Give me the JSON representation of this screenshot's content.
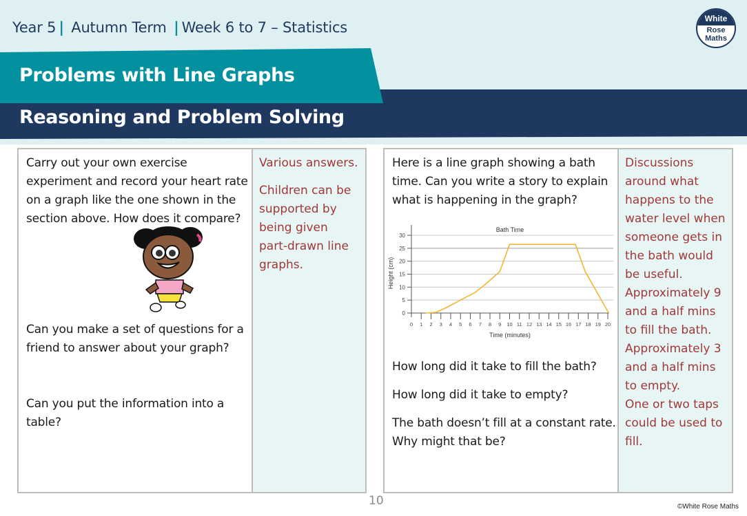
{
  "header": {
    "breadcrumb": {
      "year": "Year 5",
      "term": "Autumn Term",
      "week": "Week 6 to 7 – Statistics",
      "separator": "|"
    },
    "title": "Problems with Line Graphs",
    "subtitle": "Reasoning and Problem Solving",
    "logo": {
      "line1": "White",
      "line2": "Rose",
      "line3": "Maths"
    }
  },
  "colors": {
    "teal": "#04919f",
    "navy": "#1e3860",
    "answer_text": "#a03838",
    "answer_bg": "#e8f5f5",
    "line": "#f2b632"
  },
  "left_panel": {
    "questions": [
      "Carry out your own exercise experiment and record your heart rate on a graph like the one shown in the section above. How does it compare?",
      "Can you make a set of questions for a friend to answer about your graph?",
      "Can you put the information into a table?"
    ],
    "answers": [
      "Various answers.",
      "Children can be supported by being given part-drawn line graphs."
    ],
    "image": "girl-running-illustration"
  },
  "right_panel": {
    "intro": "Here is a line graph showing a bath time. Can you write a story to explain what is happening in the graph?",
    "questions": [
      "How long did it take to fill the bath?",
      "How long did it take to empty?",
      "The bath doesn’t fill at a constant rate. Why might that be?"
    ],
    "answers": [
      "Discussions around what happens to the water level when someone gets in the bath would be useful.",
      "Approximately 9 and a half mins to fill the bath.",
      "Approximately 3 and a half mins to empty.",
      "One or two taps could be used to fill."
    ]
  },
  "chart_data": {
    "type": "line",
    "title": "Bath Time",
    "xlabel": "Time (minutes)",
    "ylabel": "Height (cm)",
    "xlim": [
      0,
      20
    ],
    "ylim": [
      0,
      30
    ],
    "x_ticks": [
      0,
      1,
      2,
      3,
      4,
      5,
      6,
      7,
      8,
      9,
      10,
      11,
      12,
      13,
      14,
      15,
      16,
      17,
      18,
      19,
      20
    ],
    "y_ticks": [
      0,
      5,
      10,
      15,
      20,
      25,
      30
    ],
    "grid": true,
    "legend": "none",
    "series": [
      {
        "name": "Height",
        "x": [
          1.5,
          2.5,
          3.5,
          5,
          6.5,
          7.5,
          9,
          10,
          16.7,
          17.7,
          20.1
        ],
        "y": [
          0,
          0.3,
          2,
          5,
          8,
          11,
          16,
          26.5,
          26.5,
          16,
          0
        ]
      }
    ]
  },
  "footer": {
    "page_number": "10",
    "copyright": "©White Rose Maths"
  }
}
